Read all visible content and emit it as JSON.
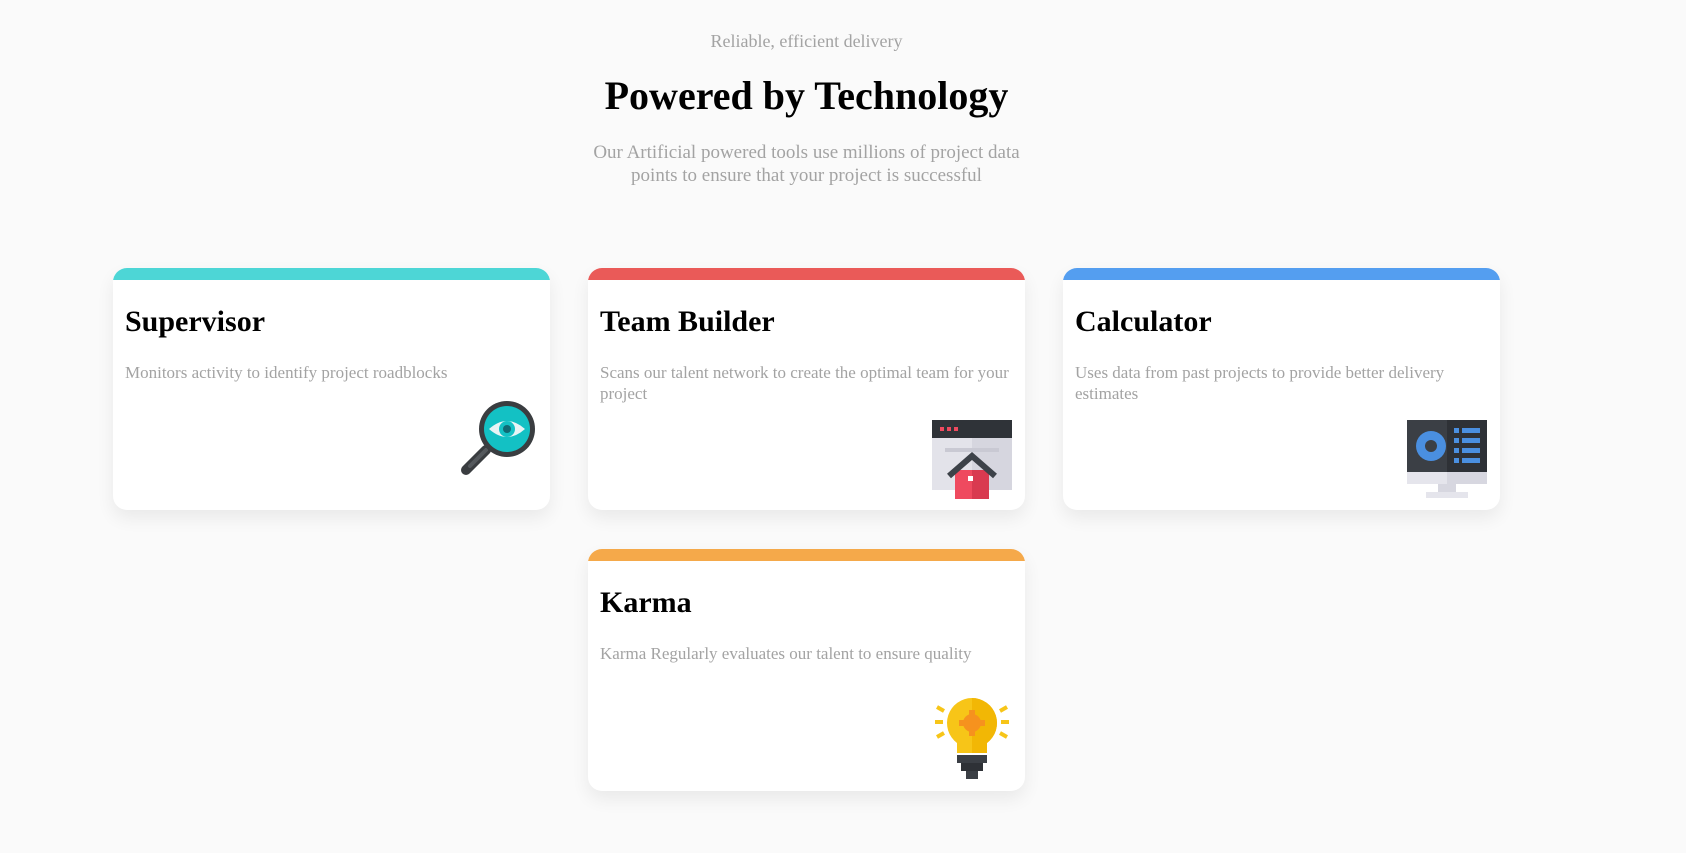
{
  "header": {
    "eyebrow": "Reliable, efficient delivery",
    "title": "Powered by Technology",
    "intro": "Our Artificial powered tools use millions of project data points to ensure that your project is successful"
  },
  "cards": [
    {
      "title": "Supervisor",
      "description": "Monitors activity to identify project roadblocks",
      "accent": "#4dd6d6",
      "icon": "magnifier-eye-icon"
    },
    {
      "title": "Team Builder",
      "description": "Scans our talent network to create the optimal team for your project",
      "accent": "#ea5a58",
      "icon": "browser-house-icon"
    },
    {
      "title": "Calculator",
      "description": "Uses data from past projects to provide better delivery estimates",
      "accent": "#549ef0",
      "icon": "monitor-dashboard-icon"
    },
    {
      "title": "Karma",
      "description": "Karma Regularly evaluates our talent to ensure quality",
      "accent": "#f5a94a",
      "icon": "lightbulb-icon"
    }
  ]
}
